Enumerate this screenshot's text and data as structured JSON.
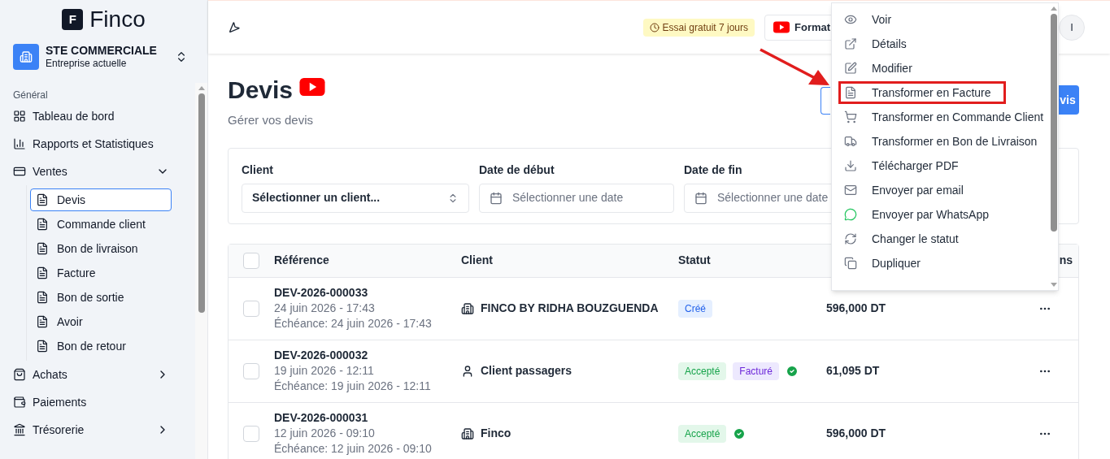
{
  "brand": {
    "logo_letter": "F",
    "name": "Finco"
  },
  "company": {
    "name": "STE COMMERCIALE",
    "subtitle": "Entreprise actuelle"
  },
  "sidebar": {
    "section": "Général",
    "items": [
      {
        "label": "Tableau de bord",
        "selected": false
      },
      {
        "label": "Rapports et Statistiques",
        "selected": false
      },
      {
        "label": "Ventes",
        "expanded": true,
        "selected": false,
        "children": [
          {
            "label": "Devis",
            "selected": true
          },
          {
            "label": "Commande client",
            "selected": false
          },
          {
            "label": "Bon de livraison",
            "selected": false
          },
          {
            "label": "Facture",
            "selected": false
          },
          {
            "label": "Bon de sortie",
            "selected": false
          },
          {
            "label": "Avoir",
            "selected": false
          },
          {
            "label": "Bon de retour",
            "selected": false
          }
        ]
      },
      {
        "label": "Achats",
        "expanded": false,
        "selected": false
      },
      {
        "label": "Paiements",
        "selected": false
      },
      {
        "label": "Trésorerie",
        "expanded": false,
        "selected": false
      }
    ]
  },
  "header": {
    "trial_badge": "Essai gratuit 7 jours",
    "format_button": "Format",
    "avatar": "I"
  },
  "page": {
    "title": "Devis",
    "subtitle": "Gérer vos devis",
    "new_button": "vis"
  },
  "filters": [
    {
      "kind": "select",
      "label": "Client",
      "value": "Sélectionner un client..."
    },
    {
      "kind": "date",
      "label": "Date de début",
      "placeholder": "Sélectionner une date"
    },
    {
      "kind": "date",
      "label": "Date de fin",
      "placeholder": "Sélectionner une date"
    }
  ],
  "table": {
    "all_checked": false,
    "columns": [
      "Référence",
      "Client",
      "Statut",
      "ns"
    ],
    "rows": [
      {
        "kind": "company",
        "reference": "DEV-2026-000033",
        "date": "24 juin 2026 - 17:43",
        "due": "Échéance: 24 juin 2026 - 17:43",
        "client": "FINCO BY RIDHA BOUZGUENDA",
        "statuses": [
          {
            "kind": "created",
            "label": "Créé"
          }
        ],
        "verified": false,
        "amount": "596,000 DT",
        "checked": false
      },
      {
        "kind": "person",
        "reference": "DEV-2026-000032",
        "date": "19 juin 2026 - 12:11",
        "due": "Échéance: 19 juin 2026 - 12:11",
        "client": "Client passagers",
        "statuses": [
          {
            "kind": "accepted",
            "label": "Accepté"
          },
          {
            "kind": "invoiced",
            "label": "Facturé"
          }
        ],
        "verified": true,
        "amount": "61,095 DT",
        "checked": false
      },
      {
        "kind": "company",
        "reference": "DEV-2026-000031",
        "date": "12 juin 2026 - 09:10",
        "due": "Échéance: 12 juin 2026 - 09:10",
        "client": "Finco",
        "statuses": [
          {
            "kind": "accepted",
            "label": "Accepté"
          }
        ],
        "verified": true,
        "amount": "596,000 DT",
        "checked": false
      }
    ]
  },
  "menu": {
    "items": [
      {
        "label": "Voir",
        "highlighted": false
      },
      {
        "label": "Détails",
        "highlighted": false
      },
      {
        "label": "Modifier",
        "highlighted": false
      },
      {
        "label": "Transformer en Facture",
        "highlighted": true
      },
      {
        "label": "Transformer en Commande Client",
        "highlighted": false
      },
      {
        "label": "Transformer en Bon de Livraison",
        "highlighted": false
      },
      {
        "label": "Télécharger PDF",
        "highlighted": false
      },
      {
        "label": "Envoyer par email",
        "highlighted": false
      },
      {
        "label": "Envoyer par WhatsApp",
        "highlighted": false
      },
      {
        "label": "Changer le statut",
        "highlighted": false
      },
      {
        "label": "Dupliquer",
        "highlighted": false
      }
    ]
  }
}
